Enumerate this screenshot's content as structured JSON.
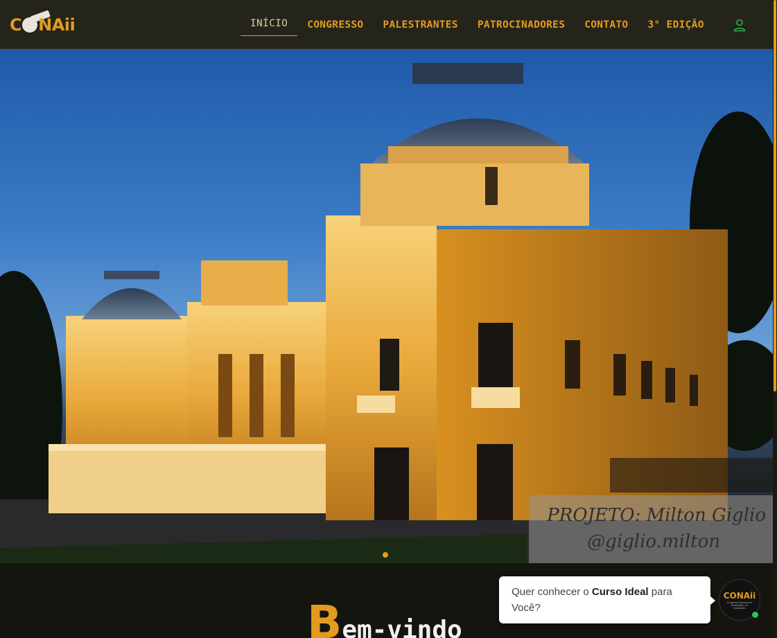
{
  "brand": {
    "logo_text": "CONAii",
    "accent": "#e49a1f",
    "nav_bg": "#25241a"
  },
  "nav": {
    "items": [
      {
        "label": "INÍCIO",
        "active": true
      },
      {
        "label": "CONGRESSO"
      },
      {
        "label": "PALESTRANTES"
      },
      {
        "label": "PATROCINADORES"
      },
      {
        "label": "CONTATO"
      },
      {
        "label": "3° EDIÇÃO"
      }
    ],
    "user_icon": "user-icon"
  },
  "hero": {
    "caption_line1": "PROJETO: Milton Giglio",
    "caption_line2": "@giglio.milton",
    "slides": 1,
    "active_slide": 1
  },
  "welcome": {
    "first_letter": "B",
    "rest": "em-vindo"
  },
  "chat": {
    "text_before": "Quer conhecer o ",
    "text_bold": "Curso Ideal",
    "text_after": " para Você?",
    "avatar_text": "CONAii",
    "avatar_tagline": "Congresso Nacional de Acreditação em Instituições",
    "status": "online"
  }
}
